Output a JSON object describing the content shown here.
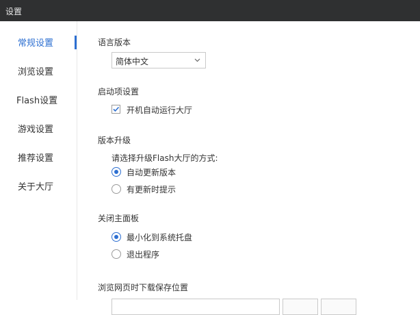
{
  "window": {
    "title": "设置"
  },
  "sidebar": {
    "items": [
      {
        "label": "常规设置",
        "active": true
      },
      {
        "label": "浏览设置",
        "active": false
      },
      {
        "label": "Flash设置",
        "active": false
      },
      {
        "label": "游戏设置",
        "active": false
      },
      {
        "label": "推荐设置",
        "active": false
      },
      {
        "label": "关于大厅",
        "active": false
      }
    ]
  },
  "language": {
    "title": "语言版本",
    "selected": "简体中文"
  },
  "startup": {
    "title": "启动项设置",
    "auto_run_label": "开机自动运行大厅",
    "auto_run_checked": true
  },
  "upgrade": {
    "title": "版本升级",
    "prompt": "请选择升级Flash大厅的方式:",
    "options": [
      {
        "label": "自动更新版本",
        "selected": true
      },
      {
        "label": "有更新时提示",
        "selected": false
      }
    ]
  },
  "close_panel": {
    "title": "关闭主面板",
    "options": [
      {
        "label": "最小化到系统托盘",
        "selected": true
      },
      {
        "label": "退出程序",
        "selected": false
      }
    ]
  },
  "download": {
    "title": "浏览网页时下载保存位置"
  },
  "colors": {
    "accent": "#2d6fd1",
    "titlebar": "#2f3031"
  }
}
